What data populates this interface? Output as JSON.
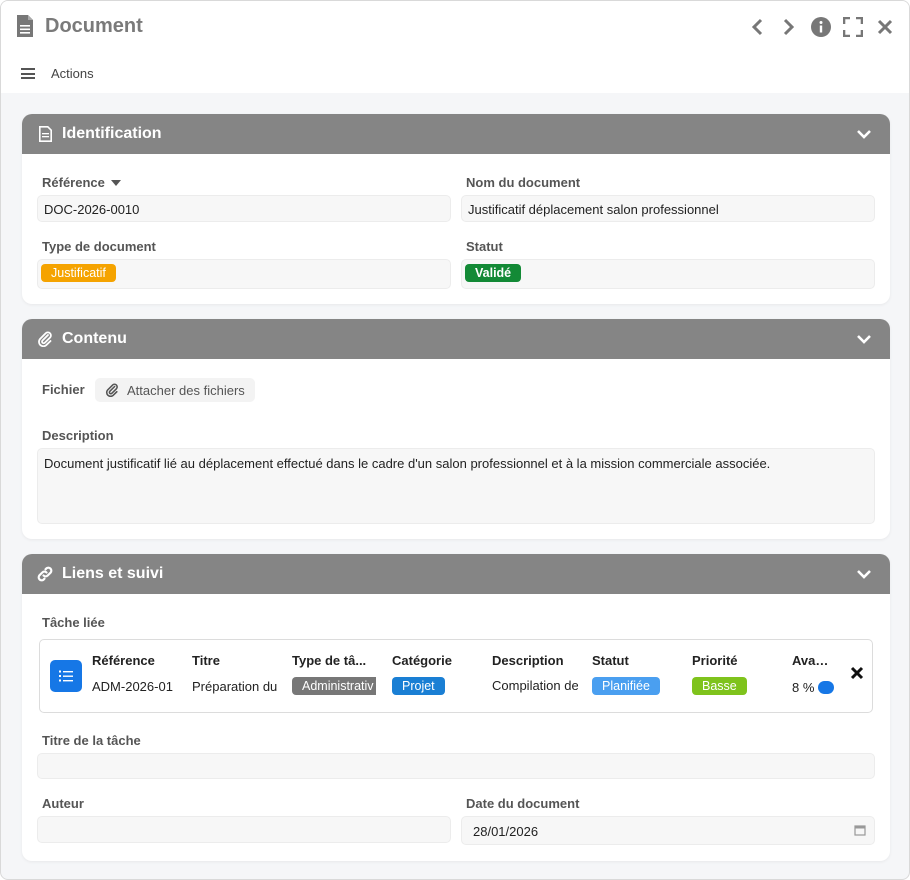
{
  "window": {
    "title": "Document"
  },
  "toolbar": {
    "actions_label": "Actions"
  },
  "identification": {
    "title": "Identification",
    "reference": {
      "label": "Référence",
      "value": "DOC-2026-0010"
    },
    "name": {
      "label": "Nom du document",
      "value": "Justificatif déplacement salon professionnel"
    },
    "type": {
      "label": "Type de document",
      "value": "Justificatif",
      "color": "#f5a300"
    },
    "status": {
      "label": "Statut",
      "value": "Validé",
      "color": "#138a36"
    }
  },
  "contenu": {
    "title": "Contenu",
    "file_label": "Fichier",
    "attach_label": "Attacher des fichiers",
    "description": {
      "label": "Description",
      "value": "Document justificatif lié au déplacement effectué dans le cadre d'un salon professionnel et à la mission commerciale associée."
    }
  },
  "liens": {
    "title": "Liens et suivi",
    "task_label": "Tâche liée",
    "task": {
      "columns": [
        "Référence",
        "Titre",
        "Type de tâ...",
        "Catégorie",
        "Description",
        "Statut",
        "Priorité",
        "Avance"
      ],
      "reference": "ADM-2026-01",
      "titre": "Préparation du",
      "type": {
        "value": "Administrativ",
        "color": "#777777"
      },
      "categorie": {
        "value": "Projet",
        "color": "#1a7fd4"
      },
      "description": "Compilation de",
      "statut": {
        "value": "Planifiée",
        "color": "#4a9ff0"
      },
      "priorite": {
        "value": "Basse",
        "color": "#7fc31c"
      },
      "avancement": "8 %"
    },
    "task_title": {
      "label": "Titre de la tâche",
      "value": ""
    },
    "author": {
      "label": "Auteur",
      "value": ""
    },
    "date": {
      "label": "Date du document",
      "value": "28/01/2026"
    }
  }
}
